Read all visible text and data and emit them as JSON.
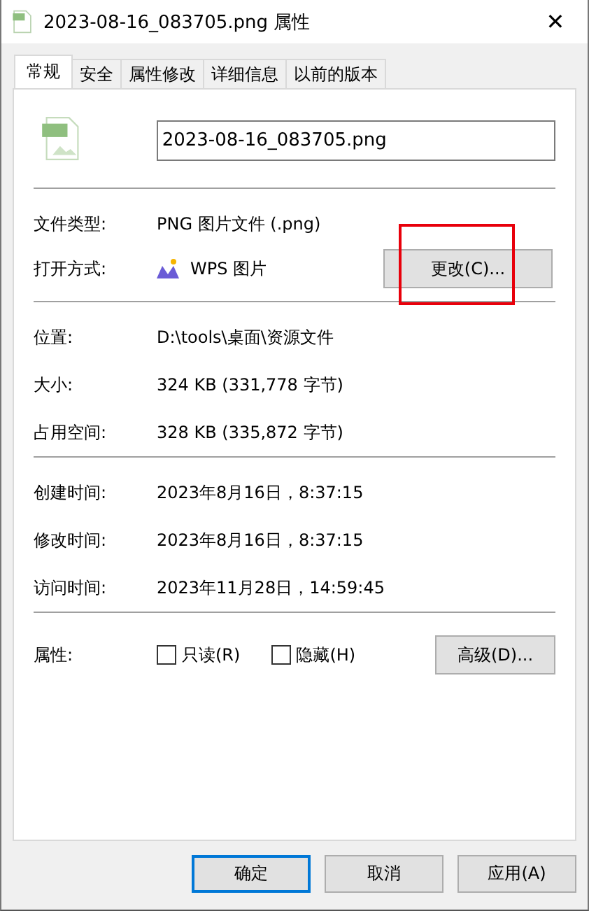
{
  "window": {
    "title": "2023-08-16_083705.png 属性",
    "close": "✕"
  },
  "tabs": [
    {
      "label": "常规",
      "selected": true
    },
    {
      "label": "安全",
      "selected": false
    },
    {
      "label": "属性修改",
      "selected": false
    },
    {
      "label": "详细信息",
      "selected": false
    },
    {
      "label": "以前的版本",
      "selected": false
    }
  ],
  "file_name": "2023-08-16_083705.png",
  "file_type": {
    "label": "文件类型:",
    "value": "PNG 图片文件 (.png)"
  },
  "open_with": {
    "label": "打开方式:",
    "app": "WPS 图片",
    "button": "更改(C)..."
  },
  "location_group": [
    {
      "label": "位置:",
      "value": "D:\\tools\\桌面\\资源文件"
    },
    {
      "label": "大小:",
      "value": "324 KB (331,778 字节)"
    },
    {
      "label": "占用空间:",
      "value": "328 KB (335,872 字节)"
    }
  ],
  "time_group": [
    {
      "label": "创建时间:",
      "value": "2023年8月16日，8:37:15"
    },
    {
      "label": "修改时间:",
      "value": "2023年8月16日，8:37:15"
    },
    {
      "label": "访问时间:",
      "value": "2023年11月28日，14:59:45"
    }
  ],
  "attributes": {
    "label": "属性:",
    "checkboxes": [
      {
        "label": "只读(R)",
        "checked": false
      },
      {
        "label": "隐藏(H)",
        "checked": false
      }
    ],
    "button": "高级(D)..."
  },
  "buttons": [
    {
      "label": "确定",
      "default": true
    },
    {
      "label": "取消",
      "default": false
    },
    {
      "label": "应用(A)",
      "default": false
    }
  ]
}
